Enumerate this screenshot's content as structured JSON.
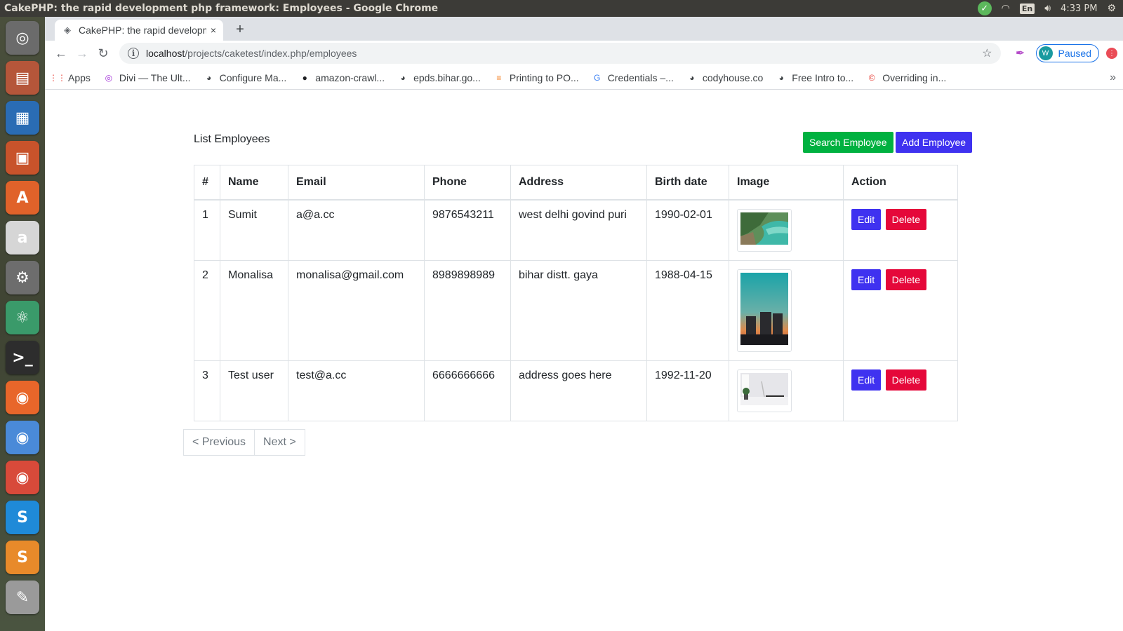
{
  "os_panel": {
    "window_title": "CakePHP: the rapid development php framework: Employees - Google Chrome",
    "lang": "En",
    "time": "4:33 PM"
  },
  "launcher": {
    "apps": [
      {
        "name": "ubuntu-dash-icon",
        "glyph": "◎",
        "color": "#6b6b6b"
      },
      {
        "name": "files-icon",
        "glyph": "▤",
        "color": "#b5563a"
      },
      {
        "name": "libreoffice-writer-icon",
        "glyph": "▦",
        "color": "#2a6cb4"
      },
      {
        "name": "libreoffice-impress-icon",
        "glyph": "▣",
        "color": "#c8532b"
      },
      {
        "name": "software-center-icon",
        "glyph": "A",
        "color": "#e0622a"
      },
      {
        "name": "amazon-icon",
        "glyph": "a",
        "color": "#d6d6d6"
      },
      {
        "name": "system-settings-icon",
        "glyph": "⚙",
        "color": "#6d6d6d"
      },
      {
        "name": "atom-icon",
        "glyph": "⚛",
        "color": "#3a9a6a"
      },
      {
        "name": "terminal-icon",
        "glyph": ">_",
        "color": "#2d2d2d"
      },
      {
        "name": "firefox-icon",
        "glyph": "◉",
        "color": "#e8662a"
      },
      {
        "name": "chromium-icon",
        "glyph": "◉",
        "color": "#4a8ad8"
      },
      {
        "name": "chrome-icon",
        "glyph": "◉",
        "color": "#d84a3a"
      },
      {
        "name": "skype-icon",
        "glyph": "S",
        "color": "#1f8ad8"
      },
      {
        "name": "sublime-text-icon",
        "glyph": "S",
        "color": "#e88a2a"
      },
      {
        "name": "text-editor-icon",
        "glyph": "✎",
        "color": "#9a9a9a"
      }
    ]
  },
  "browser": {
    "tab": {
      "title": "CakePHP: the rapid development php framework: Employees",
      "close": "×"
    },
    "new_tab": "+",
    "url": {
      "host": "localhost",
      "path": "/projects/caketest/index.php/employees"
    },
    "profile": {
      "initial": "W",
      "label": "Paused"
    },
    "bookmarks": [
      {
        "label": "Apps",
        "icon": "apps-grid-icon",
        "glyph": "⋮⋮",
        "color": "#e8453c"
      },
      {
        "label": "Divi — The Ult...",
        "icon": "divi-icon",
        "glyph": "◎",
        "color": "#a334d8"
      },
      {
        "label": "Configure Ma...",
        "icon": "globe-icon",
        "glyph": "◕",
        "color": "#3c4043"
      },
      {
        "label": "amazon-crawl...",
        "icon": "github-icon",
        "glyph": "●",
        "color": "#202124"
      },
      {
        "label": "epds.bihar.go...",
        "icon": "globe-icon",
        "glyph": "◕",
        "color": "#3c4043"
      },
      {
        "label": "Printing to PO...",
        "icon": "stackoverflow-icon",
        "glyph": "≡",
        "color": "#f48024"
      },
      {
        "label": "Credentials –...",
        "icon": "google-icon",
        "glyph": "G",
        "color": "#4285f4"
      },
      {
        "label": "codyhouse.co",
        "icon": "globe-icon",
        "glyph": "◕",
        "color": "#3c4043"
      },
      {
        "label": "Free Intro to...",
        "icon": "globe-icon",
        "glyph": "◕",
        "color": "#3c4043"
      },
      {
        "label": "Overriding in...",
        "icon": "chrome-web-icon",
        "glyph": "©",
        "color": "#e8453c"
      }
    ],
    "more": "»"
  },
  "page": {
    "title": "List Employees",
    "search_button": "Search Employee",
    "add_button": "Add Employee",
    "table": {
      "headers": [
        "#",
        "Name",
        "Email",
        "Phone",
        "Address",
        "Birth date",
        "Image",
        "Action"
      ],
      "rows": [
        {
          "id": "1",
          "name": "Sumit",
          "email": "a@a.cc",
          "phone": "9876543211",
          "address": "west delhi govind puri",
          "birth_date": "1990-02-01"
        },
        {
          "id": "2",
          "name": "Monalisa",
          "email": "monalisa@gmail.com",
          "phone": "8989898989",
          "address": "bihar distt. gaya",
          "birth_date": "1988-04-15"
        },
        {
          "id": "3",
          "name": "Test user",
          "email": "test@a.cc",
          "phone": "6666666666",
          "address": "address goes here",
          "birth_date": "1992-11-20"
        }
      ],
      "edit_label": "Edit",
      "delete_label": "Delete"
    },
    "pagination": {
      "previous": "< Previous",
      "next": "Next >"
    }
  }
}
